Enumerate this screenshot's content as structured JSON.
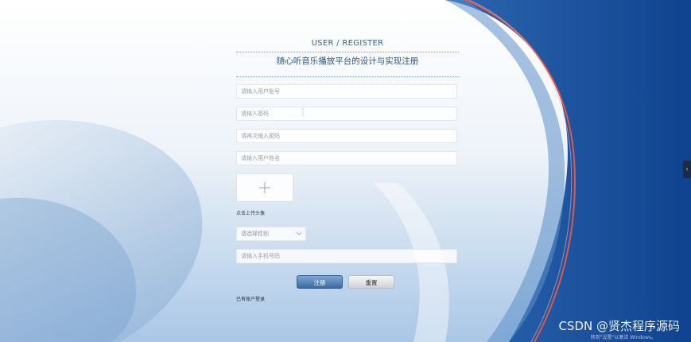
{
  "header": {
    "title_en": "USER / REGISTER",
    "title_cn": "随心听音乐播放平台的设计与实现注册"
  },
  "fields": {
    "account_placeholder": "请输入用户账号",
    "password_placeholder": "请输入密码",
    "password_confirm_placeholder": "请再次输入密码",
    "name_placeholder": "请输入用户姓名",
    "phone_placeholder": "请输入手机号码"
  },
  "avatar": {
    "hint": "点击上传头像"
  },
  "gender_select": {
    "placeholder": "请选择性别"
  },
  "buttons": {
    "register": "注册",
    "reset": "重置"
  },
  "links": {
    "login": "已有账户登录"
  },
  "side_tab": {
    "icon": "chevron-left-icon",
    "glyph": "‹"
  },
  "watermark": {
    "text": "CSDN @贤杰程序源码"
  },
  "activation_notice": {
    "text": "转到\"设置\"以激活 Windows。"
  },
  "colors": {
    "brand_blue": "#1b4f9a",
    "accent_red": "#e0584a",
    "form_text": "#2f527c"
  }
}
